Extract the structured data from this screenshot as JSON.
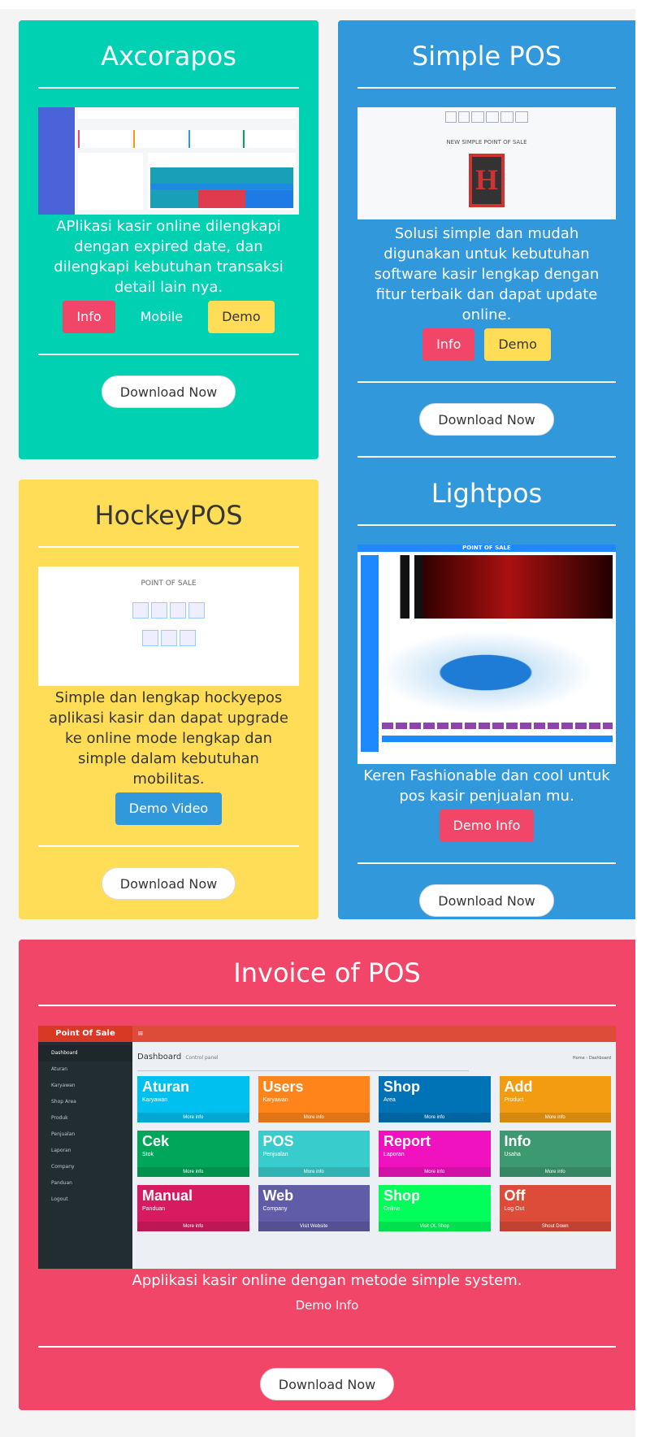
{
  "cards": {
    "axcorapos": {
      "title": "Axcorapos",
      "description": "APlikasi kasir online dilengkapi dengan expired date, dan dilengkapi kebutuhan transaksi detail lain nya.",
      "buttons": [
        "Info",
        "Mobile",
        "Demo"
      ],
      "download": "Download Now",
      "color": "#00d1b2"
    },
    "simplepos": {
      "title": "Simple POS",
      "description": "Solusi simple dan mudah digunakan untuk kebutuhan software kasir lengkap dengan fitur terbaik dan dapat update online.",
      "buttons": [
        "Info",
        "Demo"
      ],
      "download": "Download Now",
      "color": "#3298dc",
      "shot_heading": "NEW SIMPLE POINT OF SALE"
    },
    "lightpos": {
      "title": "Lightpos",
      "description": "Keren Fashionable dan cool untuk pos kasir penjualan mu.",
      "buttons": [
        "Demo Info"
      ],
      "download": "Download Now",
      "shot_heading": "POINT OF SALE"
    },
    "hockeypos": {
      "title": "HockeyPOS",
      "description": "Simple dan lengkap hockyepos aplikasi kasir dan dapat upgrade ke online mode lengkap dan simple dalam kebutuhan mobilitas.",
      "buttons": [
        "Demo Video"
      ],
      "download": "Download Now",
      "color": "#ffdd57",
      "shot_heading": "POINT OF SALE"
    },
    "invoice": {
      "title": "Invoice of POS",
      "description": "Applikasi kasir online dengan metode simple system.",
      "link": "Demo Info",
      "download": "Download Now",
      "color": "#f14668"
    }
  },
  "invoice_shot": {
    "brand": "Point Of Sale",
    "heading": "Dashboard",
    "subheading": "Control panel",
    "breadcrumb": [
      "Home",
      "Dashboard"
    ],
    "sidebar": [
      "Dashboard",
      "Aturan",
      "Karyawan",
      "Shop Area",
      "Produk",
      "Penjualan",
      "Laporan",
      "Company",
      "Panduan",
      "Logout"
    ],
    "tiles": [
      {
        "title": "Aturan",
        "sub": "Karyawan",
        "more": "More info",
        "color": "#00c0ef"
      },
      {
        "title": "Users",
        "sub": "Karyawan",
        "more": "More info",
        "color": "#ff851b"
      },
      {
        "title": "Shop",
        "sub": "Area",
        "more": "More info",
        "color": "#0073b7"
      },
      {
        "title": "Add",
        "sub": "Product",
        "more": "More info",
        "color": "#f39c12"
      },
      {
        "title": "Cek",
        "sub": "Stok",
        "more": "More info",
        "color": "#00a65a"
      },
      {
        "title": "POS",
        "sub": "Penjualan",
        "more": "More info",
        "color": "#39cccc"
      },
      {
        "title": "Report",
        "sub": "Laporan",
        "more": "More info",
        "color": "#f012be"
      },
      {
        "title": "Info",
        "sub": "Usaha",
        "more": "More info",
        "color": "#3d9970"
      },
      {
        "title": "Manual",
        "sub": "Panduan",
        "more": "More info",
        "color": "#d81b60"
      },
      {
        "title": "Web",
        "sub": "Company",
        "more": "Visit Website",
        "color": "#605ca8"
      },
      {
        "title": "Shop",
        "sub": "Online",
        "more": "Visit OL Shop",
        "color": "#00ff5a"
      },
      {
        "title": "Off",
        "sub": "Log Out",
        "more": "Shout Down",
        "color": "#dd4b39"
      }
    ]
  }
}
